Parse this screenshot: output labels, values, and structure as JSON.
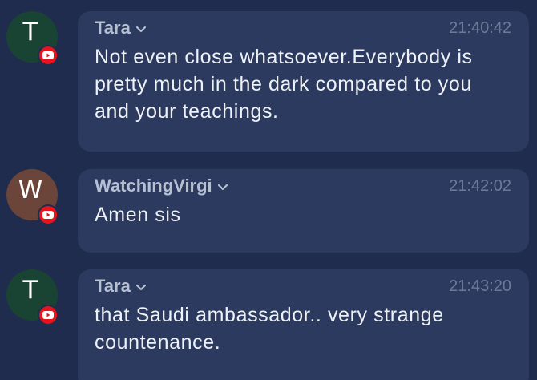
{
  "colors": {
    "background": "#1f2c4d",
    "bubble": "#2b3a5e",
    "author": "#b7c0d3",
    "timestamp": "#6c7a98",
    "message_text": "#eef1f6",
    "youtube_red": "#e8131b"
  },
  "messages": [
    {
      "avatar_letter": "T",
      "avatar_color": "#194434",
      "author": "Tara",
      "time": "21:40:42",
      "text": "Not even close whatsoever.Everybody is pretty much in the dark compared to you and your teachings.",
      "source_icon": "youtube-icon"
    },
    {
      "avatar_letter": "W",
      "avatar_color": "#6b4539",
      "author": "WatchingVirgi",
      "time": "21:42:02",
      "text": "Amen sis",
      "source_icon": "youtube-icon"
    },
    {
      "avatar_letter": "T",
      "avatar_color": "#194434",
      "author": "Tara",
      "time": "21:43:20",
      "text": "that Saudi ambassador.. very strange countenance.",
      "source_icon": "youtube-icon"
    }
  ]
}
